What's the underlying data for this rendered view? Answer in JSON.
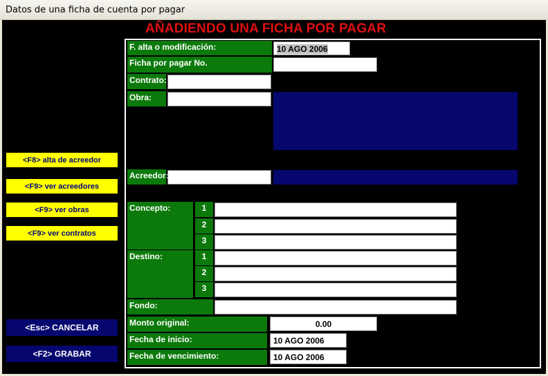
{
  "window": {
    "title": "Datos de una ficha de cuenta por pagar"
  },
  "heading": "AÑADIENDO UNA FICHA POR PAGAR",
  "side_buttons": [
    {
      "label": "<F8>  alta de acreedor"
    },
    {
      "label": "<F9>   ver acreedores"
    },
    {
      "label": "<F9>   ver obras"
    },
    {
      "label": "<F9>   ver contratos"
    }
  ],
  "action_buttons": {
    "cancel": "<Esc>  CANCELAR",
    "save": "<F2>  GRABAR"
  },
  "form": {
    "fecha_alta": {
      "label": "F. alta o modificación:",
      "value": "10 AGO 2006"
    },
    "ficha_no": {
      "label": "Ficha por pagar No.",
      "value": ""
    },
    "contrato": {
      "label": "Contrato:",
      "value": ""
    },
    "obra": {
      "label": "Obra:",
      "value": ""
    },
    "acreedor": {
      "label": "Acreedor:",
      "value": ""
    },
    "concepto": {
      "label": "Concepto:",
      "lines": [
        "1",
        "2",
        "3"
      ]
    },
    "destino": {
      "label": "Destino:",
      "lines": [
        "1",
        "2",
        "3"
      ]
    },
    "fondo": {
      "label": "Fondo:",
      "value": ""
    },
    "monto": {
      "label": "Monto original:",
      "value": "0.00"
    },
    "fecha_inicio": {
      "label": "Fecha de inicio:",
      "value": "10 AGO 2006"
    },
    "fecha_venc": {
      "label": "Fecha de vencimiento:",
      "value": "10 AGO 2006"
    }
  },
  "colors": {
    "label_bg": "#0b7a0b",
    "heading": "#e01010",
    "side_button": "#ffff00",
    "action_button": "#06076e",
    "info_box": "#06076e"
  }
}
